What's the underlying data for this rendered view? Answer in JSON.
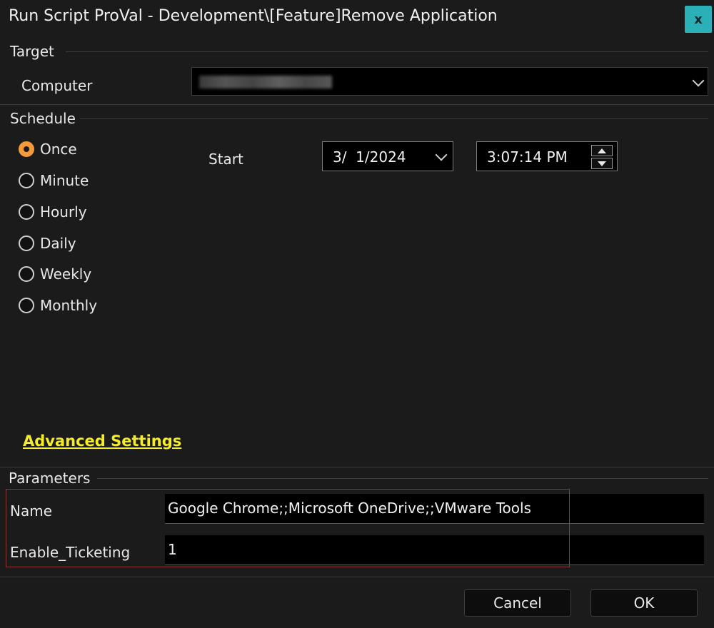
{
  "window": {
    "title": "Run Script ProVal - Development\\[Feature]Remove Application",
    "close_label": "x"
  },
  "target": {
    "section_label": "Target",
    "computer_label": "Computer",
    "computer_value": ""
  },
  "schedule": {
    "section_label": "Schedule",
    "options": [
      {
        "label": "Once",
        "checked": true
      },
      {
        "label": "Minute",
        "checked": false
      },
      {
        "label": "Hourly",
        "checked": false
      },
      {
        "label": "Daily",
        "checked": false
      },
      {
        "label": "Weekly",
        "checked": false
      },
      {
        "label": "Monthly",
        "checked": false
      }
    ],
    "start_label": "Start",
    "start_date": "3/  1/2024",
    "start_time": "3:07:14 PM"
  },
  "advanced_settings_label": "Advanced Settings",
  "parameters": {
    "section_label": "Parameters",
    "fields": [
      {
        "label": "Name",
        "value": "Google Chrome;;Microsoft OneDrive;;VMware Tools"
      },
      {
        "label": "Enable_Ticketing",
        "value": "1"
      }
    ]
  },
  "buttons": {
    "cancel": "Cancel",
    "ok": "OK"
  },
  "colors": {
    "background": "#1b1b1b",
    "close_button": "#2bb0b8",
    "radio_selected": "#f59a3a",
    "advanced_link": "#f5ec2a",
    "highlight_border": "#8a3a3a"
  }
}
